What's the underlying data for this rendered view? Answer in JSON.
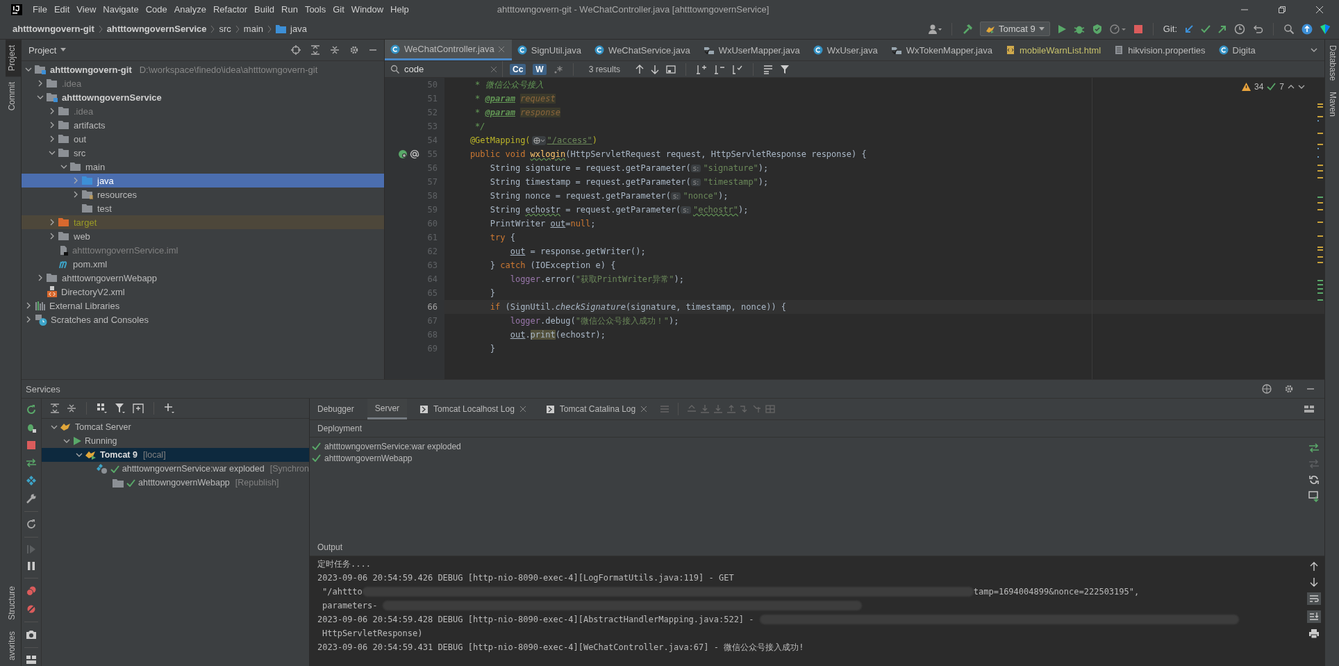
{
  "window": {
    "title": "ahtttowngovern-git - WeChatController.java [ahtttowngovernService]"
  },
  "menu": [
    "File",
    "Edit",
    "View",
    "Navigate",
    "Code",
    "Analyze",
    "Refactor",
    "Build",
    "Run",
    "Tools",
    "Git",
    "Window",
    "Help"
  ],
  "breadcrumbs": [
    "ahtttowngovern-git",
    "ahtttowngovernService",
    "src",
    "main",
    "java"
  ],
  "toolbar": {
    "run_config": "Tomcat 9",
    "vcs_label": "Git:"
  },
  "left_strip": {
    "top": [
      {
        "label": "Project",
        "selected": true
      },
      {
        "label": "Commit",
        "selected": false
      }
    ],
    "bottom": [
      {
        "label": "Structure",
        "selected": false
      },
      {
        "label": "avorites",
        "selected": false
      }
    ]
  },
  "right_strip": [
    "Database",
    "Maven"
  ],
  "project": {
    "title": "Project",
    "tree": [
      {
        "label": "ahtttowngovern-git",
        "path": "D:\\workspace\\finedo\\idea\\ahtttowngovern-git",
        "kind": "module",
        "expanded": true,
        "selected": false,
        "children": [
          {
            "label": ".idea",
            "kind": "hidden-folder",
            "expanded": false,
            "selected": false
          },
          {
            "label": "ahtttowngovernService",
            "kind": "module",
            "expanded": true,
            "selected": false,
            "children": [
              {
                "label": ".idea",
                "kind": "hidden-folder",
                "expanded": false,
                "selected": false
              },
              {
                "label": "artifacts",
                "kind": "folder",
                "expanded": false,
                "selected": false
              },
              {
                "label": "out",
                "kind": "folder",
                "expanded": false,
                "selected": false
              },
              {
                "label": "src",
                "kind": "folder",
                "expanded": true,
                "selected": false,
                "children": [
                  {
                    "label": "main",
                    "kind": "folder",
                    "expanded": true,
                    "selected": false,
                    "children": [
                      {
                        "label": "java",
                        "kind": "source-folder",
                        "expanded": false,
                        "selected": true
                      },
                      {
                        "label": "resources",
                        "kind": "resources-folder",
                        "expanded": false,
                        "selected": false
                      },
                      {
                        "label": "test",
                        "kind": "folder",
                        "selected": false
                      }
                    ]
                  }
                ]
              },
              {
                "label": "target",
                "kind": "excluded-folder",
                "expanded": false,
                "selected": false
              },
              {
                "label": "web",
                "kind": "folder",
                "expanded": false,
                "selected": false
              },
              {
                "label": "ahtttowngovernService.iml",
                "kind": "iml-file",
                "selected": false
              },
              {
                "label": "pom.xml",
                "kind": "maven-file",
                "selected": false
              }
            ]
          },
          {
            "label": "ahtttowngovernWebapp",
            "kind": "folder",
            "expanded": false,
            "selected": false
          },
          {
            "label": "DirectoryV2.xml",
            "kind": "xml-file",
            "selected": false
          }
        ]
      },
      {
        "label": "External Libraries",
        "kind": "libraries",
        "expanded": false,
        "selected": false
      },
      {
        "label": "Scratches and Consoles",
        "kind": "scratches",
        "expanded": false,
        "selected": false
      }
    ]
  },
  "editor_tabs": [
    {
      "label": "WeChatController.java",
      "kind": "class",
      "selected": true
    },
    {
      "label": "SignUtil.java",
      "kind": "class",
      "selected": false
    },
    {
      "label": "WeChatService.java",
      "kind": "class",
      "selected": false
    },
    {
      "label": "WxUserMapper.java",
      "kind": "mapper",
      "selected": false
    },
    {
      "label": "WxUser.java",
      "kind": "class",
      "selected": false
    },
    {
      "label": "WxTokenMapper.java",
      "kind": "mapper",
      "selected": false
    },
    {
      "label": "mobileWarnList.html",
      "kind": "html",
      "selected": false
    },
    {
      "label": "hikvision.properties",
      "kind": "properties",
      "selected": false
    },
    {
      "label": "Digita",
      "kind": "class",
      "selected": false
    }
  ],
  "search": {
    "value": "code",
    "toggles": [
      {
        "label": "Cc",
        "selected": true
      },
      {
        "label": "W",
        "selected": true
      }
    ],
    "results": "3 results"
  },
  "inspections": {
    "warnings": "34",
    "weak_warnings": "7"
  },
  "code": [
    {
      "n": "50",
      "kind": "doc",
      "tokens": [
        {
          "kind": "doc",
          "s": "* 微信公众号接入"
        }
      ]
    },
    {
      "n": "51",
      "kind": "doc",
      "tokens": [
        {
          "kind": "doc",
          "s": "*"
        },
        {
          "kind": "doctag",
          "s": "@param"
        },
        {
          "kind": "docparam",
          "s": "request"
        }
      ]
    },
    {
      "n": "52",
      "kind": "doc",
      "tokens": [
        {
          "kind": "doc",
          "s": "*"
        },
        {
          "kind": "doctag",
          "s": "@param"
        },
        {
          "kind": "docparam",
          "s": "response"
        }
      ]
    },
    {
      "n": "53",
      "kind": "doc",
      "tokens": [
        {
          "kind": "doc",
          "s": "*/"
        }
      ]
    },
    {
      "n": "54",
      "kind": "member",
      "tokens": [
        {
          "kind": "ann",
          "s": "@GetMapping("
        },
        {
          "kind": "url-inlay"
        },
        {
          "kind": "link",
          "s": "\"/access\""
        },
        {
          "kind": "ann",
          "s": ")"
        }
      ]
    },
    {
      "n": "55",
      "kind": "member",
      "gutter": true,
      "tokens": [
        {
          "kind": "kw",
          "s": "public void "
        },
        {
          "kind": "decl",
          "s": "wxlogin"
        },
        {
          "kind": "plain",
          "s": "(HttpServletRequest request, HttpServletResponse response) {"
        }
      ]
    },
    {
      "n": "56",
      "kind": "body",
      "tokens": [
        {
          "kind": "plain",
          "s": "String signature = request.getParameter("
        },
        {
          "kind": "hint",
          "s": "s:"
        },
        {
          "kind": "str",
          "s": "\"signature\""
        },
        {
          "kind": "plain",
          "s": ");"
        }
      ]
    },
    {
      "n": "57",
      "kind": "body",
      "tokens": [
        {
          "kind": "plain",
          "s": "String timestamp = request.getParameter("
        },
        {
          "kind": "hint",
          "s": "s:"
        },
        {
          "kind": "str",
          "s": "\"timestamp\""
        },
        {
          "kind": "plain",
          "s": ");"
        }
      ]
    },
    {
      "n": "58",
      "kind": "body",
      "tokens": [
        {
          "kind": "plain",
          "s": "String nonce = request.getParameter("
        },
        {
          "kind": "hint",
          "s": "s:"
        },
        {
          "kind": "str",
          "s": "\"nonce\""
        },
        {
          "kind": "plain",
          "s": ");"
        }
      ]
    },
    {
      "n": "59",
      "kind": "body",
      "tokens": [
        {
          "kind": "plain",
          "s": "String "
        },
        {
          "kind": "typo",
          "s": "echostr"
        },
        {
          "kind": "plain",
          "s": " = request.getParameter("
        },
        {
          "kind": "hint",
          "s": "s:"
        },
        {
          "kind": "strtypo",
          "s": "\"echostr\""
        },
        {
          "kind": "plain",
          "s": ");"
        }
      ]
    },
    {
      "n": "60",
      "kind": "body",
      "tokens": [
        {
          "kind": "plain",
          "s": "PrintWriter "
        },
        {
          "kind": "under",
          "s": "out"
        },
        {
          "kind": "plain",
          "s": "="
        },
        {
          "kind": "kw",
          "s": "null"
        },
        {
          "kind": "plain",
          "s": ";"
        }
      ]
    },
    {
      "n": "61",
      "kind": "body",
      "tokens": [
        {
          "kind": "kw",
          "s": "try"
        },
        {
          "kind": "plain",
          "s": " {"
        }
      ]
    },
    {
      "n": "62",
      "kind": "nested",
      "tokens": [
        {
          "kind": "under",
          "s": "out"
        },
        {
          "kind": "plain",
          "s": " = response.getWriter();"
        }
      ]
    },
    {
      "n": "63",
      "kind": "body",
      "tokens": [
        {
          "kind": "plain",
          "s": "} "
        },
        {
          "kind": "kw",
          "s": "catch"
        },
        {
          "kind": "plain",
          "s": " (IOException e) {"
        }
      ]
    },
    {
      "n": "64",
      "kind": "nested",
      "tokens": [
        {
          "kind": "field",
          "s": "logger"
        },
        {
          "kind": "plain",
          "s": ".error("
        },
        {
          "kind": "str",
          "s": "\"获取PrintWriter异常\""
        },
        {
          "kind": "plain",
          "s": ");"
        }
      ]
    },
    {
      "n": "65",
      "kind": "body",
      "tokens": [
        {
          "kind": "plain",
          "s": "}"
        }
      ]
    },
    {
      "n": "66",
      "kind": "body",
      "current": true,
      "tokens": [
        {
          "kind": "kw",
          "s": "if"
        },
        {
          "kind": "plain",
          "s": " (SignUtil."
        },
        {
          "kind": "static",
          "s": "checkSignature"
        },
        {
          "kind": "plain",
          "s": "(signature, timestamp, nonce)) {"
        }
      ]
    },
    {
      "n": "67",
      "kind": "nested",
      "tokens": [
        {
          "kind": "field",
          "s": "logger"
        },
        {
          "kind": "plain",
          "s": ".debug("
        },
        {
          "kind": "str",
          "s": "\"微信公众号接入成功！\""
        },
        {
          "kind": "plain",
          "s": ");"
        }
      ]
    },
    {
      "n": "68",
      "kind": "nested",
      "tokens": [
        {
          "kind": "under",
          "s": "out"
        },
        {
          "kind": "plain",
          "s": "."
        },
        {
          "kind": "match",
          "s": "print"
        },
        {
          "kind": "plain",
          "s": "(echostr);"
        }
      ]
    },
    {
      "n": "69",
      "kind": "body",
      "tokens": [
        {
          "kind": "plain",
          "s": "}"
        }
      ]
    }
  ],
  "services": {
    "title": "Services",
    "tree": [
      {
        "label": "Tomcat Server",
        "kind": "server",
        "expanded": true,
        "selected": false,
        "children": [
          {
            "label": "Running",
            "kind": "running",
            "expanded": true,
            "selected": false,
            "children": [
              {
                "label": "Tomcat 9",
                "note": "[local]",
                "kind": "instance",
                "expanded": true,
                "selected": true,
                "children": [
                  {
                    "label": "ahtttowngovernService:war exploded",
                    "note": "[Synchron",
                    "kind": "artifact",
                    "deployed": true,
                    "selected": false
                  },
                  {
                    "label": "ahtttowngovernWebapp",
                    "note": "[Republish]",
                    "kind": "webapp",
                    "deployed": true,
                    "selected": false
                  }
                ]
              }
            ]
          }
        ]
      }
    ],
    "tabs": [
      {
        "label": "Debugger",
        "kind": "plain",
        "selected": false
      },
      {
        "label": "Server",
        "kind": "plain",
        "selected": true
      },
      {
        "label": "Tomcat Localhost Log",
        "kind": "log",
        "selected": false
      },
      {
        "label": "Tomcat Catalina Log",
        "kind": "log",
        "selected": false
      }
    ],
    "deployment_title": "Deployment",
    "deployment": [
      {
        "label": "ahtttowngovernService:war exploded",
        "deployed": true
      },
      {
        "label": "ahtttowngovernWebapp",
        "deployed": true
      }
    ],
    "output_title": "Output",
    "output": [
      {
        "kind": "entry",
        "segments": [
          "定时任务...."
        ]
      },
      {
        "kind": "entry",
        "segments": [
          "2023-09-06 20:54:59.426 DEBUG [http-nio-8090-exec-4][LogFormatUtils.java:119] - GET"
        ]
      },
      {
        "kind": "continuation",
        "segments": [
          "\"/ahttto",
          "tamp=1694004899&nonce=222503195\","
        ]
      },
      {
        "kind": "continuation",
        "segments": [
          "parameters-"
        ],
        "redacted_tail": true
      },
      {
        "kind": "entry",
        "segments": [
          "2023-09-06 20:54:59.428 DEBUG [http-nio-8090-exec-4][AbstractHandlerMapping.java:522] -"
        ],
        "redacted_tail": true
      },
      {
        "kind": "continuation",
        "segments": [
          "HttpServletResponse)"
        ]
      },
      {
        "kind": "entry",
        "segments": [
          "2023-09-06 20:54:59.431 DEBUG [http-nio-8090-exec-4][WeChatController.java:67] - 微信公众号接入成功!"
        ]
      }
    ]
  }
}
